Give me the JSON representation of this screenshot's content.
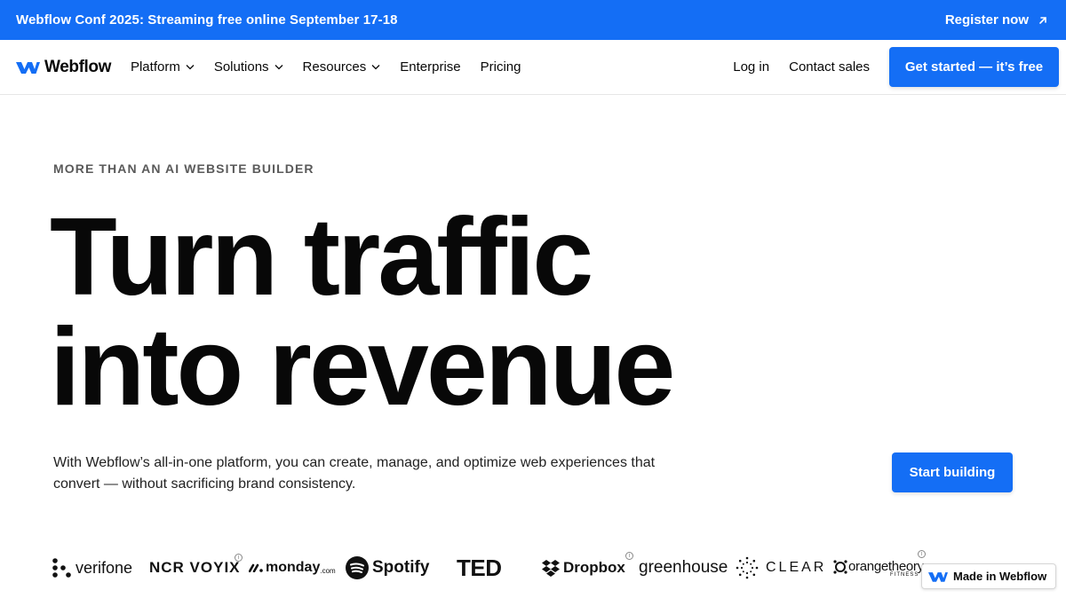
{
  "banner": {
    "text": "Webflow Conf 2025: Streaming free online September 17-18",
    "link_label": "Register now",
    "link_icon": "arrow-up-right-icon"
  },
  "nav": {
    "brand": "Webflow",
    "items": [
      {
        "label": "Platform",
        "has_dropdown": true
      },
      {
        "label": "Solutions",
        "has_dropdown": true
      },
      {
        "label": "Resources",
        "has_dropdown": true
      },
      {
        "label": "Enterprise",
        "has_dropdown": false
      },
      {
        "label": "Pricing",
        "has_dropdown": false
      }
    ],
    "login": "Log in",
    "contact": "Contact sales",
    "cta": "Get started — it’s free"
  },
  "hero": {
    "eyebrow": "MORE THAN AN AI WEBSITE BUILDER",
    "headline_line1": "Turn traffic",
    "headline_line2": "into revenue",
    "subtext": "With Webflow’s all-in-one platform, you can create, manage, and optimize web experiences that convert — without sacrificing brand consistency.",
    "cta": "Start building"
  },
  "logos": {
    "verifone": "verifone",
    "ncr": "NCR VOYIX",
    "monday": "monday",
    "monday_suffix": ".com",
    "spotify": "Spotify",
    "ted": "TED",
    "dropbox": "Dropbox",
    "greenhouse": "greenhouse",
    "clear": "CLEAR",
    "orangetheory": "orangetheory",
    "orangetheory_sub": "FITNESS"
  },
  "badge": {
    "label": "Made in Webflow"
  },
  "colors": {
    "brand_blue": "#146ef5",
    "text": "#080808",
    "muted": "#5a5a5a"
  }
}
